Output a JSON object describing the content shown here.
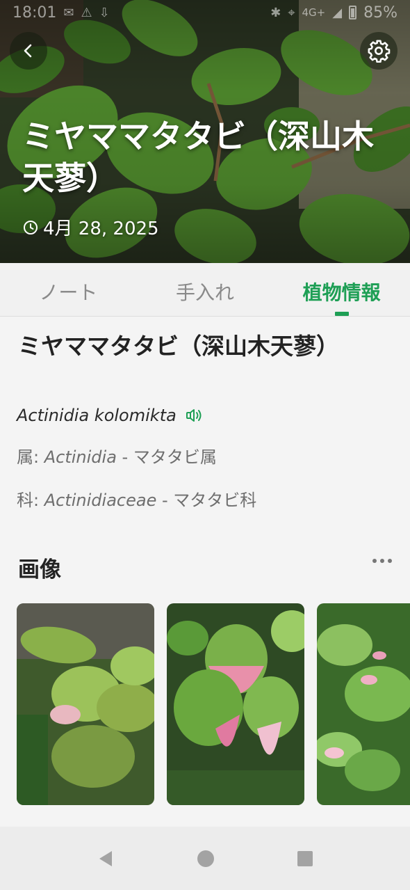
{
  "status_bar": {
    "time": "18:01",
    "network": "4G+",
    "battery": "85%"
  },
  "header": {
    "title": "ミヤママタタビ（深山木天蓼）",
    "date": "4月 28, 2025",
    "back_icon": "chevron-left-icon",
    "settings_icon": "gear-icon"
  },
  "tabs": [
    {
      "label": "ノート",
      "active": false
    },
    {
      "label": "手入れ",
      "active": false
    },
    {
      "label": "植物情報",
      "active": true
    }
  ],
  "plant": {
    "name": "ミヤママタタビ（深山木天蓼）",
    "scientific_name": "Actinidia kolomikta",
    "genus_label": "属:",
    "genus_latin": "Actinidia",
    "genus_jp": " - マタタビ属",
    "family_label": "科:",
    "family_latin": "Actinidiaceae",
    "family_jp": " - マタタビ科"
  },
  "images_section": {
    "title": "画像"
  },
  "colors": {
    "accent": "#1e9f55"
  }
}
